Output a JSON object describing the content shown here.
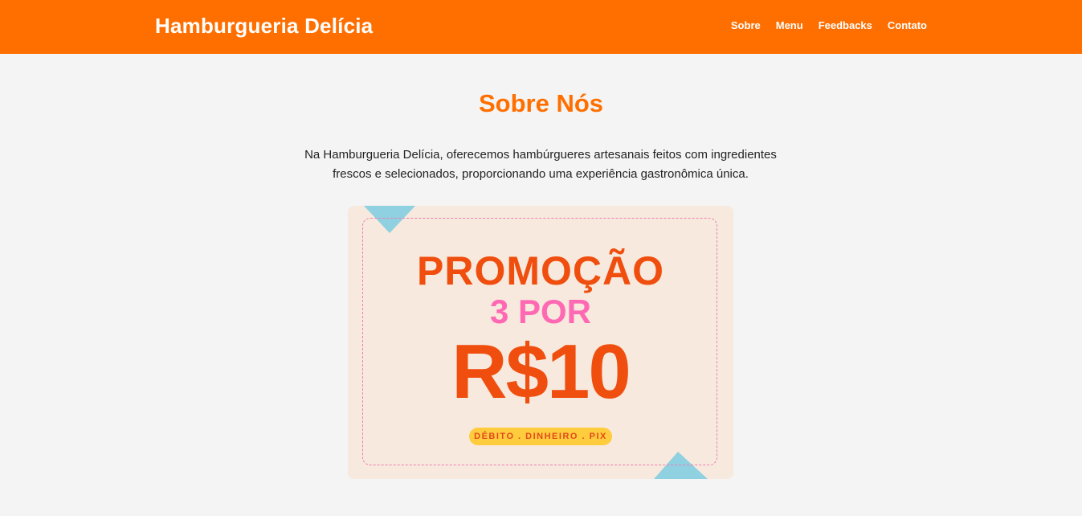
{
  "header": {
    "brand": "Hamburgueria Delícia",
    "nav": [
      "Sobre",
      "Menu",
      "Feedbacks",
      "Contato"
    ]
  },
  "about": {
    "title": "Sobre Nós",
    "description": "Na Hamburgueria Delícia, oferecemos hambúrgueres artesanais feitos com ingredientes frescos e selecionados, proporcionando uma experiência gastronômica única."
  },
  "promo": {
    "line1": "PROMOÇÃO",
    "line2": "3 POR",
    "line3": "R$10",
    "payment": "DÉBITO . DINHEIRO . PIX"
  },
  "colors": {
    "primary": "#ff6f00",
    "background": "#f4f4f4",
    "promo_bg": "#f7e9dd",
    "promo_orange": "#f04e0e",
    "promo_pink": "#ff69b4",
    "promo_yellow": "#ffcc3d",
    "star_blue": "#8fd0e1"
  }
}
